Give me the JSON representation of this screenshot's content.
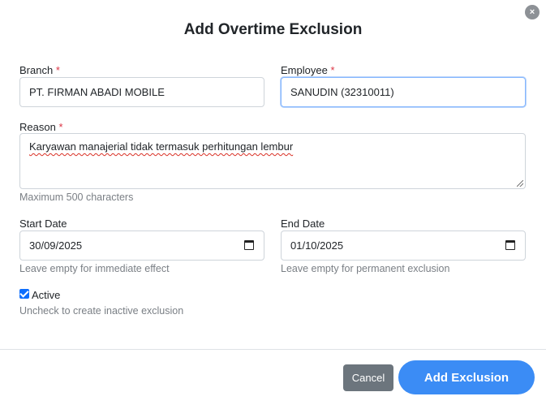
{
  "dialog": {
    "title": "Add Overtime Exclusion",
    "close_symbol": "×"
  },
  "branch": {
    "label": "Branch",
    "required_mark": "*",
    "value": "PT. FIRMAN ABADI MOBILE"
  },
  "employee": {
    "label": "Employee",
    "required_mark": "*",
    "value": "SANUDIN (32310011)"
  },
  "reason": {
    "label": "Reason",
    "required_mark": "*",
    "value": "Karyawan manajerial tidak termasuk perhitungan lembur",
    "help": "Maximum 500 characters"
  },
  "start_date": {
    "label": "Start Date",
    "value": "30/09/2025",
    "help": "Leave empty for immediate effect"
  },
  "end_date": {
    "label": "End Date",
    "value": "01/10/2025",
    "help": "Leave empty for permanent exclusion"
  },
  "active": {
    "label": "Active",
    "checked": true,
    "help": "Uncheck to create inactive exclusion"
  },
  "footer": {
    "cancel_label": "Cancel",
    "submit_label": "Add Exclusion"
  },
  "colors": {
    "primary": "#3b8cf5",
    "secondary": "#6c757d",
    "required": "#dc3545"
  }
}
